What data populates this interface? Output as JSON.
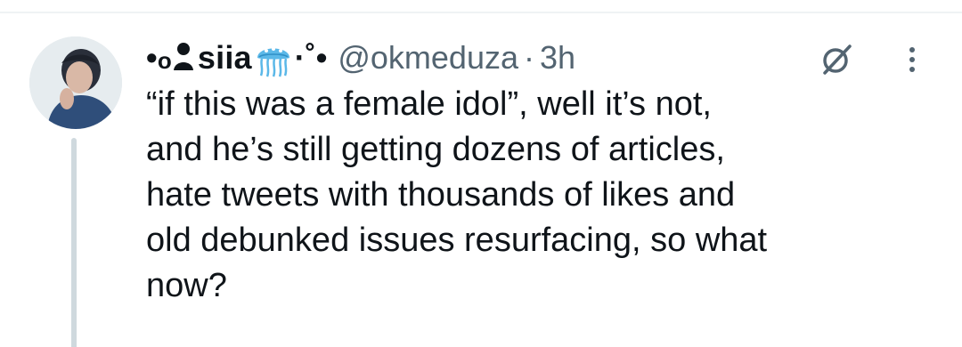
{
  "tweet": {
    "display_name_prefix": "•",
    "display_name_mid": "o",
    "display_name": "siia",
    "name_emoji": "jellyfish-emoji",
    "display_name_suffix": "·˚•",
    "handle": "@okmeduza",
    "separator": "·",
    "time": "3h",
    "text": "“if this was a female idol”, well it’s not,\nand he’s still getting dozens of articles,\nhate tweets with thousands of likes and\nold debunked issues resurfacing, so what\nnow?"
  },
  "icons": {
    "grok": "grok-icon",
    "more": "more-vertical-icon",
    "person": "person-icon"
  },
  "colors": {
    "text": "#0f1419",
    "secondary": "#536471",
    "thread_line": "#cfd9de",
    "jellyfish": "#5bb8e8"
  }
}
